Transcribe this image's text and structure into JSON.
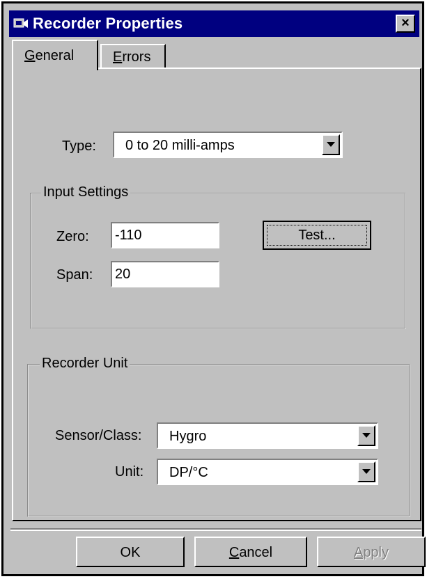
{
  "window": {
    "title": "Recorder Properties",
    "title_icon": "app-icon",
    "close_label": "×"
  },
  "tabs": [
    {
      "label_underline": "G",
      "label_rest": "eneral",
      "selected": true
    },
    {
      "label_underline": "E",
      "label_rest": "rrors",
      "selected": false
    }
  ],
  "general": {
    "type_label": "Type:",
    "type_value": "0 to 20 milli-amps",
    "input_settings": {
      "legend": "Input Settings",
      "zero_label": "Zero:",
      "zero_value": "-110",
      "span_label": "Span:",
      "span_value": "20",
      "test_label": "Test..."
    },
    "recorder_unit": {
      "legend": "Recorder Unit",
      "sensor_label": "Sensor/Class:",
      "sensor_value": "Hygro",
      "unit_label": "Unit:",
      "unit_value": "DP/°C"
    }
  },
  "footer": {
    "ok_label": "OK",
    "cancel_underline": "C",
    "cancel_rest": "ancel",
    "apply_underline": "A",
    "apply_rest": "pply",
    "apply_disabled": true
  },
  "colors": {
    "titlebar": "#000080",
    "face": "#c0c0c0",
    "disabled_text": "#808080"
  }
}
